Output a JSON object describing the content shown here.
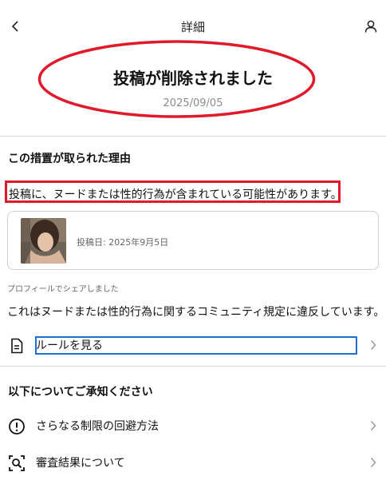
{
  "header": {
    "title": "詳細"
  },
  "hero": {
    "title": "投稿が削除されました",
    "date": "2025/09/05",
    "highlight_color": "#e01a2b"
  },
  "reason_section": {
    "heading": "この措置が取られた理由",
    "reason": "投稿に、ヌードまたは性的行為が含まれている可能性があります。",
    "post_card": {
      "date": "投稿日: 2025年9月5日"
    },
    "shared_note": "プロフィールでシェアしました",
    "violation": "これはヌードまたは性的行為に関するコミュニティ規定に違反しています。",
    "rules_link": "ルールを見る"
  },
  "notice_section": {
    "heading": "以下についてご承知ください",
    "items": [
      {
        "label": "さらなる制限の回避方法",
        "icon": "alert-circle-icon"
      },
      {
        "label": "審査結果について",
        "icon": "search-review-icon"
      }
    ]
  },
  "colors": {
    "accent_blue": "#1a6fd0",
    "highlight_red": "#e01a2b"
  }
}
